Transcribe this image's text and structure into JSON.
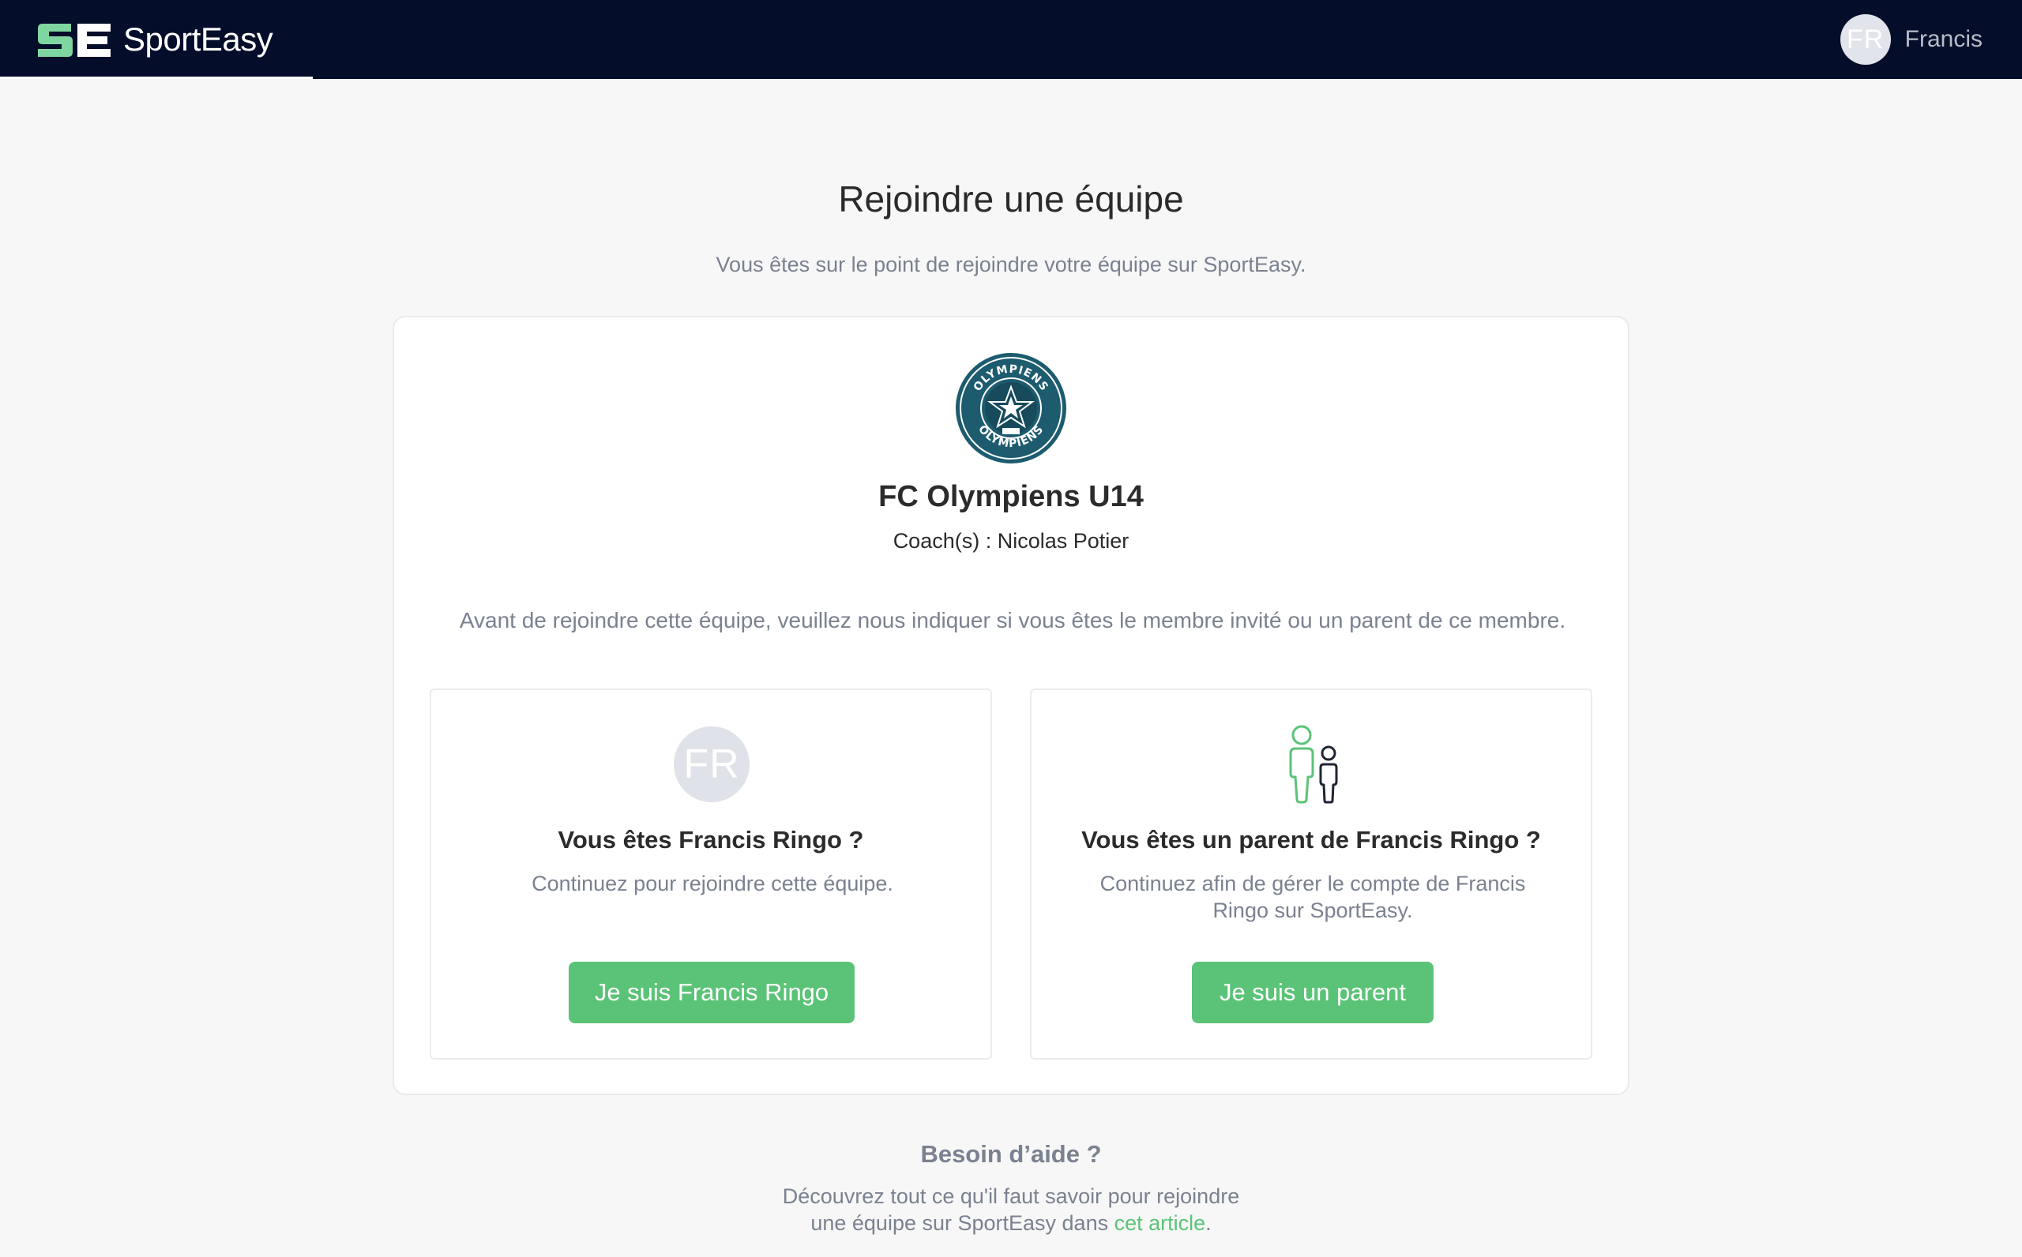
{
  "header": {
    "brand_name": "SportEasy",
    "user": {
      "initials": "FR",
      "name": "Francis"
    }
  },
  "page": {
    "title": "Rejoindre une équipe",
    "subtitle": "Vous êtes sur le point de rejoindre votre équipe sur SportEasy."
  },
  "team": {
    "logo_text_top": "OLYMPIENS",
    "logo_text_bottom": "OLYMPIENS",
    "name": "FC Olympiens U14",
    "coaches": "Coach(s) : Nicolas Potier"
  },
  "intro": "Avant de rejoindre cette équipe, veuillez nous indiquer si vous êtes le membre invité ou un parent de ce membre.",
  "options": {
    "member": {
      "initials": "FR",
      "title": "Vous êtes Francis Ringo ?",
      "text": "Continuez pour rejoindre cette équipe.",
      "button": "Je suis Francis Ringo"
    },
    "parent": {
      "title": "Vous êtes un parent de Francis Ringo ?",
      "text": "Continuez afin de gérer le compte de Francis Ringo sur SportEasy.",
      "button": "Je suis un parent"
    }
  },
  "help": {
    "title": "Besoin d’aide ?",
    "text_line1": "Découvrez tout ce qu'il faut savoir pour rejoindre",
    "text_line2": "une équipe sur SportEasy dans ",
    "link": "cet article",
    "text_end": "."
  },
  "colors": {
    "navbar": "#040d2a",
    "accent_green": "#5bc377",
    "logo_green": "#7fd6a0",
    "team_logo_blue": "#1d5b6f",
    "muted_text": "#7a8190",
    "background": "#f7f7f7"
  }
}
